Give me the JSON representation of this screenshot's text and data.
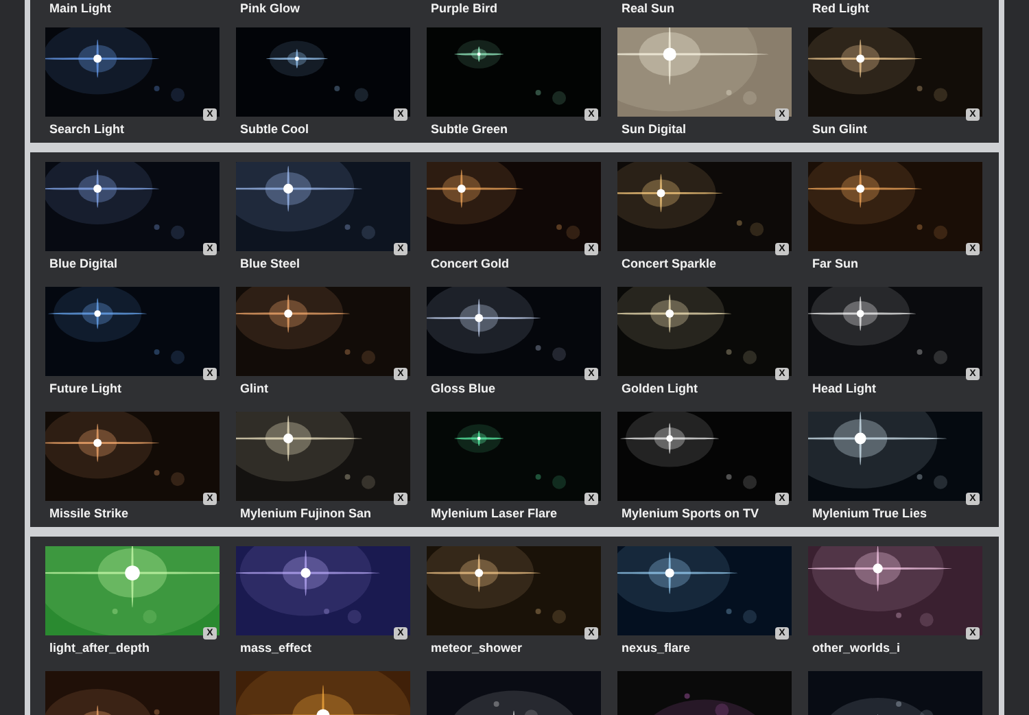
{
  "panels": [
    {
      "rows": [
        {
          "tiles": [
            {
              "kind": "cut-top",
              "label": "Main Light"
            },
            {
              "kind": "cut-top",
              "label": "Pink Glow"
            },
            {
              "kind": "cut-top",
              "label": "Purple Bird"
            },
            {
              "kind": "cut-top",
              "label": "Real Sun"
            },
            {
              "kind": "cut-top",
              "label": "Red Light"
            }
          ]
        },
        {
          "tiles": [
            {
              "kind": "preset",
              "label": "Search Light",
              "remove": "X"
            },
            {
              "kind": "preset",
              "label": "Subtle Cool",
              "remove": "X"
            },
            {
              "kind": "preset",
              "label": "Subtle Green",
              "remove": "X"
            },
            {
              "kind": "preset",
              "label": "Sun Digital",
              "remove": "X"
            },
            {
              "kind": "preset",
              "label": "Sun Glint",
              "remove": "X"
            }
          ]
        }
      ]
    },
    {
      "rows": [
        {
          "tiles": [
            {
              "kind": "preset",
              "label": "Blue Digital",
              "remove": "X"
            },
            {
              "kind": "preset",
              "label": "Blue Steel",
              "remove": "X"
            },
            {
              "kind": "preset",
              "label": "Concert Gold",
              "remove": "X"
            },
            {
              "kind": "preset",
              "label": "Concert Sparkle",
              "remove": "X"
            },
            {
              "kind": "preset",
              "label": "Far Sun",
              "remove": "X"
            }
          ]
        },
        {
          "tiles": [
            {
              "kind": "preset",
              "label": "Future Light",
              "remove": "X"
            },
            {
              "kind": "preset",
              "label": "Glint",
              "remove": "X"
            },
            {
              "kind": "preset",
              "label": "Gloss Blue",
              "remove": "X"
            },
            {
              "kind": "preset",
              "label": "Golden Light",
              "remove": "X"
            },
            {
              "kind": "preset",
              "label": "Head Light",
              "remove": "X"
            }
          ]
        },
        {
          "tiles": [
            {
              "kind": "preset",
              "label": "Missile Strike",
              "remove": "X"
            },
            {
              "kind": "preset",
              "label": "Mylenium Fujinon San",
              "remove": "X"
            },
            {
              "kind": "preset",
              "label": "Mylenium Laser Flare",
              "remove": "X"
            },
            {
              "kind": "preset",
              "label": "Mylenium Sports on TV",
              "remove": "X"
            },
            {
              "kind": "preset",
              "label": "Mylenium True Lies",
              "remove": "X"
            }
          ]
        }
      ]
    },
    {
      "rows": [
        {
          "tiles": [
            {
              "kind": "preset",
              "label": "light_after_depth",
              "remove": "X"
            },
            {
              "kind": "preset",
              "label": "mass_effect",
              "remove": "X"
            },
            {
              "kind": "preset",
              "label": "meteor_shower",
              "remove": "X"
            },
            {
              "kind": "preset",
              "label": "nexus_flare",
              "remove": "X"
            },
            {
              "kind": "preset",
              "label": "other_worlds_i",
              "remove": "X"
            }
          ]
        },
        {
          "tiles": [
            {
              "kind": "partial"
            },
            {
              "kind": "partial"
            },
            {
              "kind": "partial"
            },
            {
              "kind": "partial"
            },
            {
              "kind": "partial"
            }
          ]
        }
      ]
    }
  ]
}
